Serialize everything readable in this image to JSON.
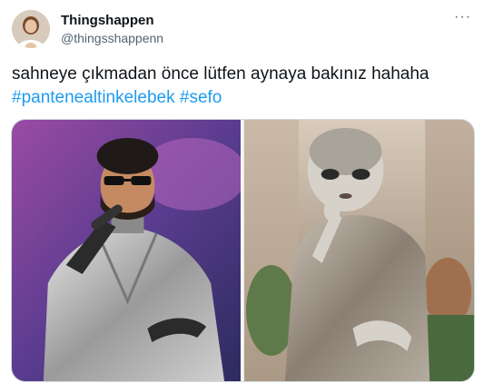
{
  "author": {
    "display_name": "Thingshappen",
    "handle": "@thingsshappenn",
    "avatar_icon": "avatar-icon"
  },
  "more_icon_glyph": "···",
  "tweet": {
    "text": "sahneye çıkmadan önce lütfen aynaya bakınız hahaha",
    "hashtags": [
      "#pantenealtinkelebek",
      "#sefo"
    ]
  },
  "media": [
    {
      "icon": "performer-photo"
    },
    {
      "icon": "alien-photo"
    }
  ],
  "colors": {
    "link": "#1d9bf0",
    "text": "#0f1419",
    "secondary": "#536471",
    "border": "#cfd9de"
  }
}
